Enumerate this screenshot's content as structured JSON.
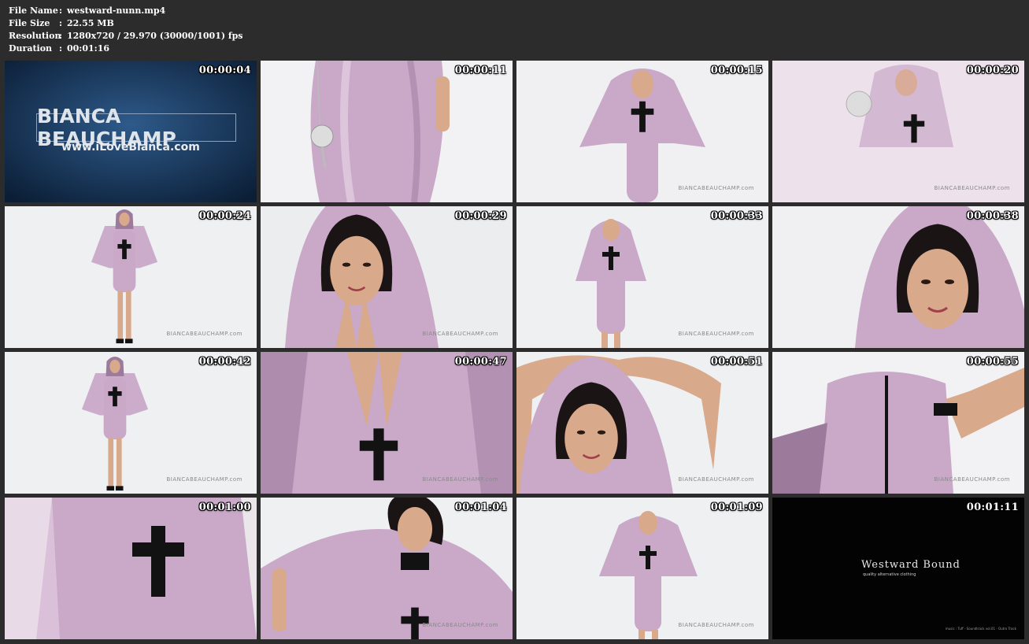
{
  "file_info": {
    "rows": [
      {
        "label": "File Name",
        "sep": ":",
        "value": "westward-nunn.mp4"
      },
      {
        "label": "File Size",
        "sep": ":",
        "value": "22.55 MB"
      },
      {
        "label": "Resolution",
        "sep": ":",
        "value": "1280x720 / 29.970 (30000/1001) fps"
      },
      {
        "label": "Duration",
        "sep": ":",
        "value": "00:01:16"
      }
    ]
  },
  "thumbnails": [
    {
      "time": "00:00:04"
    },
    {
      "time": "00:00:11"
    },
    {
      "time": "00:00:15",
      "watermark": "BIANCABEAUCHAMP.com"
    },
    {
      "time": "00:00:20",
      "watermark": "BIANCABEAUCHAMP.com"
    },
    {
      "time": "00:00:24",
      "watermark": "BIANCABEAUCHAMP.com"
    },
    {
      "time": "00:00:29",
      "watermark": "BIANCABEAUCHAMP.com"
    },
    {
      "time": "00:00:33",
      "watermark": "BIANCABEAUCHAMP.com"
    },
    {
      "time": "00:00:38"
    },
    {
      "time": "00:00:42",
      "watermark": "BIANCABEAUCHAMP.com"
    },
    {
      "time": "00:00:47",
      "watermark": "BIANCABEAUCHAMP.com"
    },
    {
      "time": "00:00:51",
      "watermark": "BIANCABEAUCHAMP.com"
    },
    {
      "time": "00:00:55",
      "watermark": "BIANCABEAUCHAMP.com"
    },
    {
      "time": "00:01:00"
    },
    {
      "time": "00:01:04",
      "watermark": "BIANCABEAUCHAMP.com"
    },
    {
      "time": "00:01:09",
      "watermark": "BIANCABEAUCHAMP.com"
    },
    {
      "time": "00:01:11"
    }
  ],
  "title_card": {
    "brand": "BIANCA BEAUCHAMP",
    "url": "www.iLoveBianca.com"
  },
  "end_card": {
    "logo": "Westward Bound",
    "tagline": "quality alternative clothing",
    "credit": "music : Tuff - Soundtrack vol.01 - Outro Track"
  },
  "colors": {
    "background": "#2c2c2c",
    "latex": "#c9a8c8",
    "studio": "#eceef0"
  }
}
